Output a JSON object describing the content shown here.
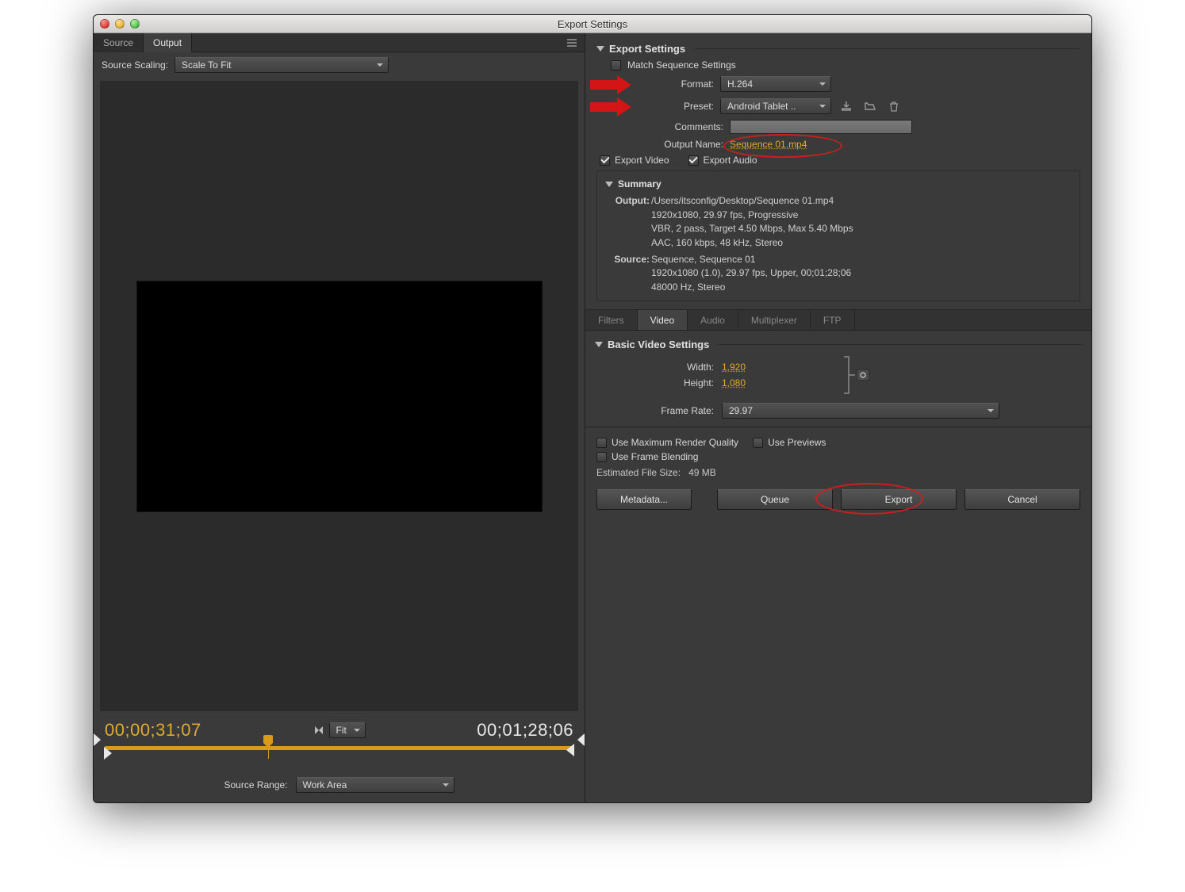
{
  "window": {
    "title": "Export Settings"
  },
  "leftPanel": {
    "tabs": {
      "source": "Source",
      "output": "Output"
    },
    "sourceScalingLabel": "Source Scaling:",
    "sourceScalingValue": "Scale To Fit",
    "timecodeIn": "00;00;31;07",
    "timecodeOut": "00;01;28;06",
    "zoom": "Fit",
    "sourceRangeLabel": "Source Range:",
    "sourceRangeValue": "Work Area"
  },
  "export": {
    "sectionTitle": "Export Settings",
    "matchSeqLabel": "Match Sequence Settings",
    "formatLabel": "Format:",
    "formatValue": "H.264",
    "presetLabel": "Preset:",
    "presetValue": "Android Tablet ..",
    "commentsLabel": "Comments:",
    "outputNameLabel": "Output Name:",
    "outputNameValue": "Sequence 01.mp4",
    "exportVideoLabel": "Export Video",
    "exportAudioLabel": "Export Audio"
  },
  "summary": {
    "title": "Summary",
    "outputLabel": "Output:",
    "outputPath": "/Users/itsconfig/Desktop/Sequence 01.mp4",
    "outputLine2": "1920x1080, 29.97 fps, Progressive",
    "outputLine3": "VBR, 2 pass, Target 4.50 Mbps, Max 5.40 Mbps",
    "outputLine4": "AAC, 160 kbps, 48 kHz, Stereo",
    "sourceLabel": "Source:",
    "sourceLine1": "Sequence, Sequence 01",
    "sourceLine2": "1920x1080 (1.0), 29.97 fps, Upper, 00;01;28;06",
    "sourceLine3": "48000 Hz, Stereo"
  },
  "subtabs": {
    "filters": "Filters",
    "video": "Video",
    "audio": "Audio",
    "multiplexer": "Multiplexer",
    "ftp": "FTP"
  },
  "basicVideo": {
    "title": "Basic Video Settings",
    "widthLabel": "Width:",
    "widthValue": "1,920",
    "heightLabel": "Height:",
    "heightValue": "1,080",
    "frameRateLabel": "Frame Rate:",
    "frameRateValue": "29.97"
  },
  "footer": {
    "maxRender": "Use Maximum Render Quality",
    "usePreviews": "Use Previews",
    "frameBlend": "Use Frame Blending",
    "estLabel": "Estimated File Size:",
    "estValue": "49 MB",
    "metadata": "Metadata...",
    "queue": "Queue",
    "export": "Export",
    "cancel": "Cancel"
  }
}
